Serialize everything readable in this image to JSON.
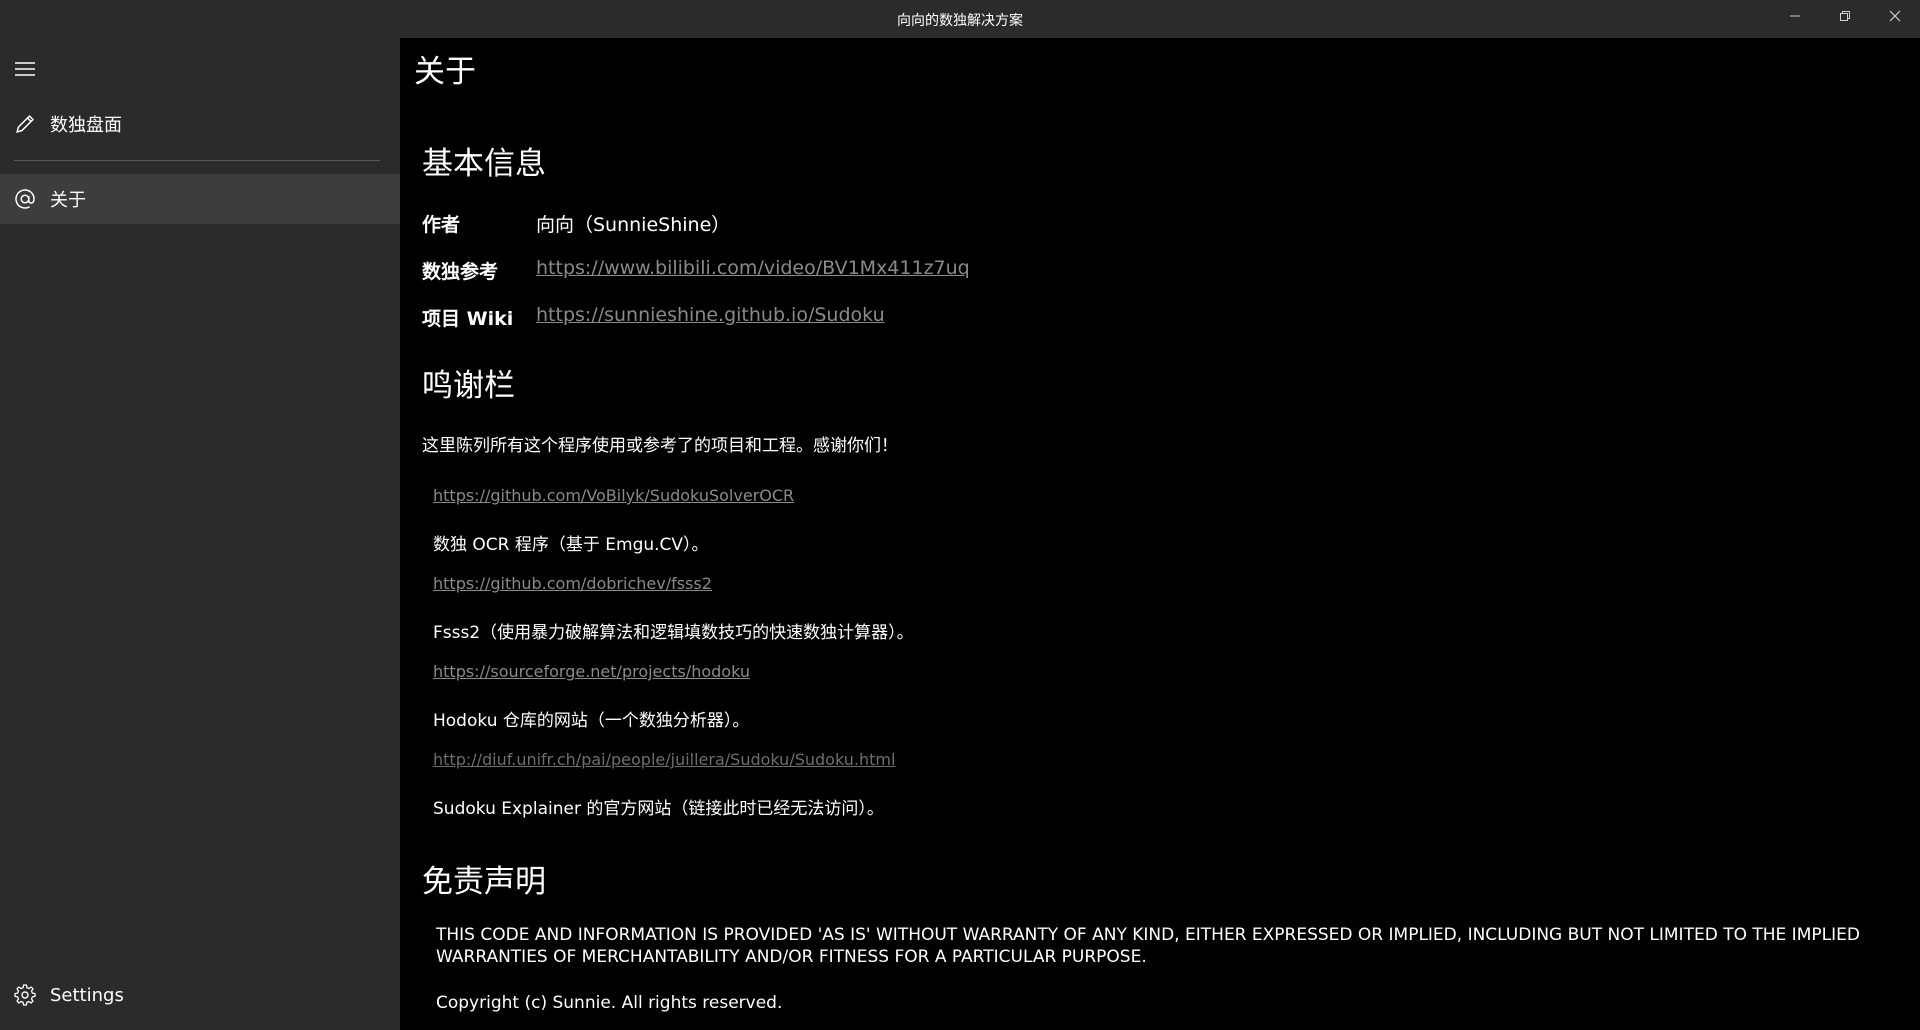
{
  "window": {
    "title": "向向的数独解决方案",
    "buttons": {
      "minimize": "minimize-icon",
      "restore": "restore-icon",
      "close": "close-icon"
    }
  },
  "sidebar": {
    "menu_icon": "hamburger-icon",
    "items": [
      {
        "label": "数独盘面",
        "icon": "pencil-icon",
        "selected": false
      },
      {
        "label": "关于",
        "icon": "at-icon",
        "selected": true
      }
    ],
    "footer": {
      "label": "Settings",
      "icon": "gear-icon"
    }
  },
  "content": {
    "page_title": "关于",
    "basic_info": {
      "heading": "基本信息",
      "rows": [
        {
          "label": "作者",
          "value": "向向（SunnieShine）",
          "is_link": false
        },
        {
          "label": "数独参考",
          "value": "https://www.bilibili.com/video/BV1Mx411z7uq",
          "is_link": true
        },
        {
          "label": "项目 Wiki",
          "value": "https://sunnieshine.github.io/Sudoku",
          "is_link": true
        }
      ]
    },
    "credits": {
      "heading": "鸣谢栏",
      "intro": "这里陈列所有这个程序使用或参考了的项目和工程。感谢你们！",
      "items": [
        {
          "link": "https://github.com/VoBilyk/SudokuSolverOCR",
          "desc": "数独 OCR 程序（基于 Emgu.CV）。"
        },
        {
          "link": "https://github.com/dobrichev/fsss2",
          "desc": "Fsss2（使用暴力破解算法和逻辑填数技巧的快速数独计算器）。"
        },
        {
          "link": "https://sourceforge.net/projects/hodoku",
          "desc": "Hodoku 仓库的网站（一个数独分析器）。"
        },
        {
          "link": "http://diuf.unifr.ch/pai/people/juillera/Sudoku/Sudoku.html",
          "desc": "Sudoku Explainer 的官方网站（链接此时已经无法访问）。"
        }
      ]
    },
    "disclaimer": {
      "heading": "免责声明",
      "text": "THIS CODE AND INFORMATION IS PROVIDED 'AS IS' WITHOUT WARRANTY OF ANY KIND, EITHER EXPRESSED OR IMPLIED, INCLUDING BUT NOT LIMITED TO THE IMPLIED WARRANTIES OF MERCHANTABILITY AND/OR FITNESS FOR A PARTICULAR PURPOSE.",
      "copyright": "Copyright (c) Sunnie. All rights reserved."
    }
  }
}
